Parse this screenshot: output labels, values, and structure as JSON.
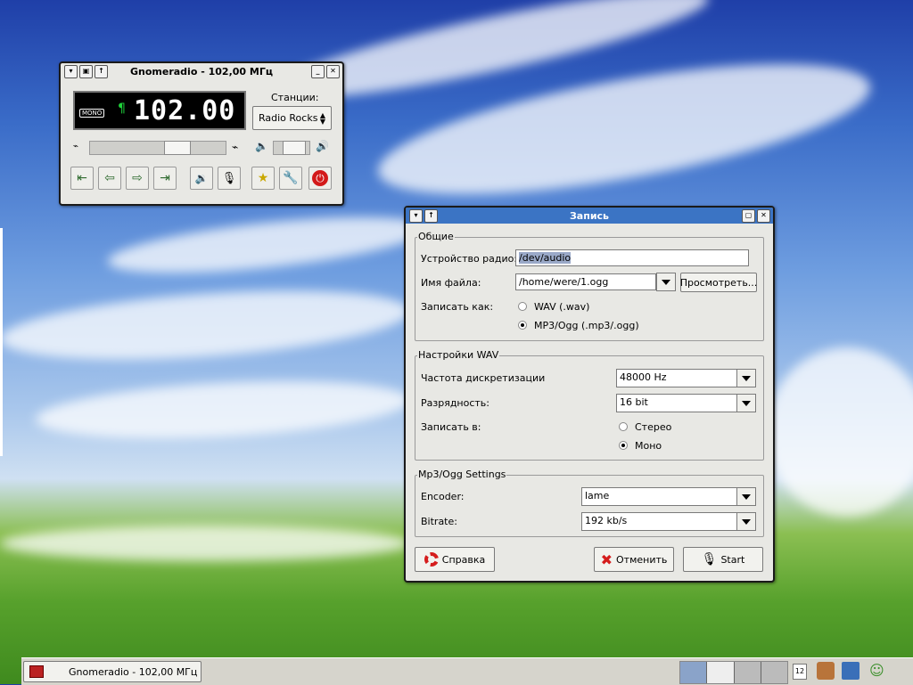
{
  "radio_window": {
    "title": "Gnomeradio - 102,00 МГц",
    "mode_badge": "MONO",
    "frequency": "102.00",
    "stations_label": "Станции:",
    "station_selected": "Radio Rocks",
    "tuning_level": 0.55,
    "volume_level": 0.45
  },
  "record_dialog": {
    "title": "Запись",
    "general": {
      "title": "Общие",
      "device_label": "Устройство радио:",
      "device_value": "/dev/audio",
      "filename_label": "Имя файла:",
      "filename_value": "/home/were/1.ogg",
      "browse_button": "Просмотреть...",
      "record_as_label": "Записать как:",
      "option_wav": "WAV (.wav)",
      "option_mp3": "MP3/Ogg (.mp3/.ogg)",
      "selected": "mp3"
    },
    "wav": {
      "title": "Настройки WAV",
      "samplerate_label": "Частота дискретизации",
      "samplerate_value": "48000 Hz",
      "bits_label": "Разрядность:",
      "bits_value": "16 bit",
      "channels_label": "Записать в:",
      "option_stereo": "Стерео",
      "option_mono": "Моно",
      "selected": "mono"
    },
    "mp3": {
      "title": "Mp3/Ogg Settings",
      "encoder_label": "Encoder:",
      "encoder_value": "lame",
      "bitrate_label": "Bitrate:",
      "bitrate_value": "192 kb/s"
    },
    "buttons": {
      "help": "Справка",
      "cancel": "Отменить",
      "start": "Start"
    }
  },
  "taskbar": {
    "task_label": "Gnomeradio - 102,00 МГц",
    "calendar_day": "12"
  }
}
